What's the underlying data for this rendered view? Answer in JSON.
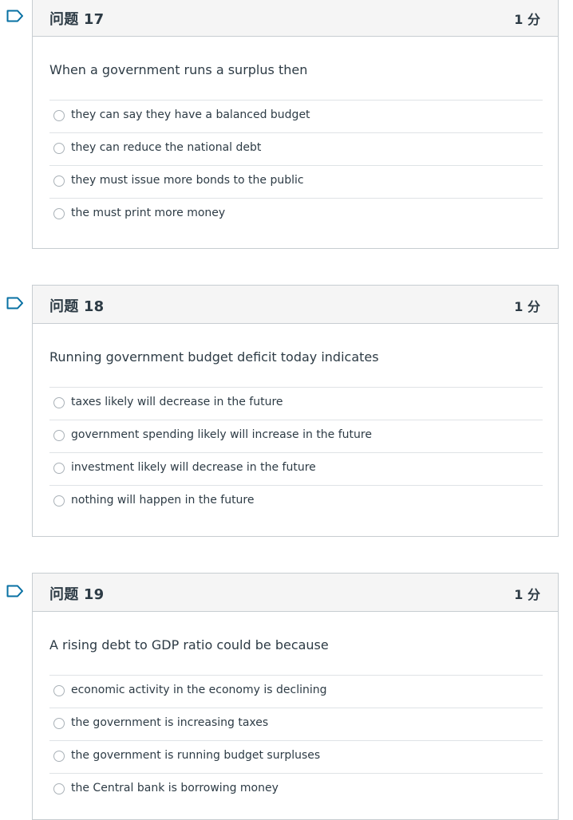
{
  "colors": {
    "flag_outline": "#0770a3",
    "header_bg": "#f5f5f5",
    "border": "#c7cdd1",
    "text": "#2d3b45"
  },
  "questions": [
    {
      "title": "问题 17",
      "points": "1 分",
      "text": "When a government runs a surplus then",
      "flag_icon": "flag-outline-icon",
      "answers": [
        "they can say they have a balanced budget",
        "they can reduce the national debt",
        "they must issue more bonds to the public",
        "the must print more money"
      ]
    },
    {
      "title": "问题 18",
      "points": "1 分",
      "text": "Running government budget deficit today indicates",
      "flag_icon": "flag-outline-icon",
      "answers": [
        "taxes likely will decrease in the future",
        "government spending likely will increase in the future",
        "investment likely will decrease in the future",
        "nothing will happen in the future"
      ]
    },
    {
      "title": "问题 19",
      "points": "1 分",
      "text": "A rising debt to GDP ratio could be because",
      "flag_icon": "flag-outline-icon",
      "answers": [
        "economic activity in the economy is declining",
        "the government is increasing taxes",
        "the government is running budget surpluses",
        "the Central bank is borrowing money"
      ]
    }
  ]
}
